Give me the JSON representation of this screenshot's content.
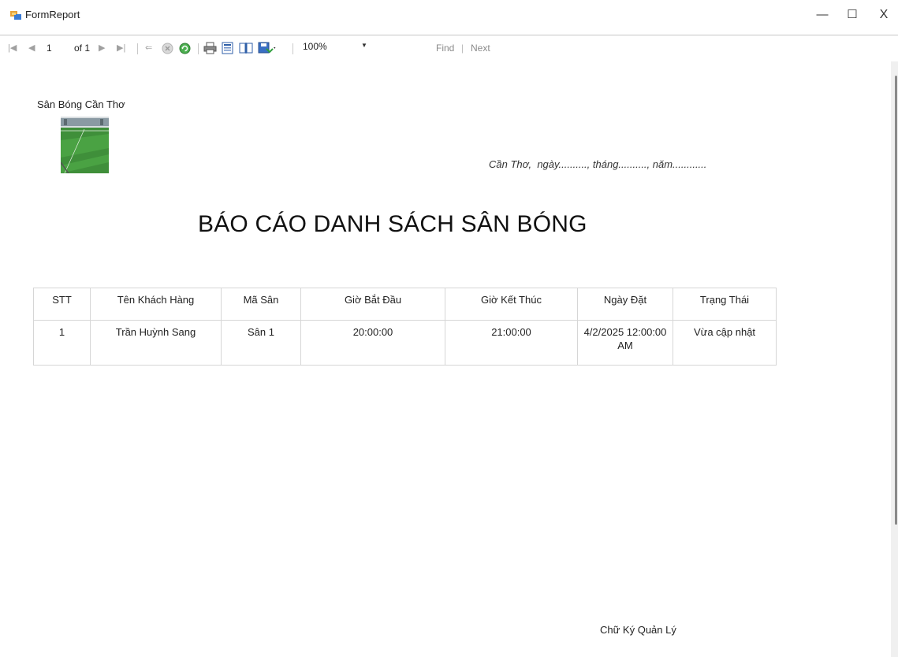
{
  "window": {
    "title": "FormReport",
    "controls": {
      "minimize": "—",
      "maximize": "☐",
      "close": "X"
    }
  },
  "toolbar": {
    "page_current": "1",
    "page_of": "of 1",
    "zoom": "100%",
    "find_label": "Find",
    "separator": "|",
    "next_label": "Next",
    "icons": [
      "first-page-icon",
      "prev-page-icon",
      "next-page-icon",
      "last-page-icon",
      "back-icon",
      "stop-icon",
      "refresh-icon",
      "print-icon",
      "print-layout-icon",
      "page-setup-icon",
      "export-icon"
    ]
  },
  "report": {
    "company_name": "Sân Bóng Cần Thơ",
    "dateline": "Cần Thơ,  ngày.........., tháng.........., năm............",
    "title": "BÁO CÁO DANH SÁCH SÂN BÓNG",
    "table": {
      "headers": [
        "STT",
        "Tên Khách Hàng",
        "Mã Sân",
        "Giờ Bắt Đầu",
        "Giờ Kết Thúc",
        "Ngày Đặt",
        "Trạng Thái"
      ],
      "rows": [
        [
          "1",
          "Trần Huỳnh Sang",
          "Sân 1",
          "20:00:00",
          "21:00:00",
          "4/2/2025 12:00:00 AM",
          "Vừa cập nhật"
        ]
      ]
    },
    "signature": "Chữ Ký Quản Lý"
  },
  "colors": {
    "field_green": "#3f8f3a",
    "toolbar_icon_gray": "#a0a0a0"
  }
}
